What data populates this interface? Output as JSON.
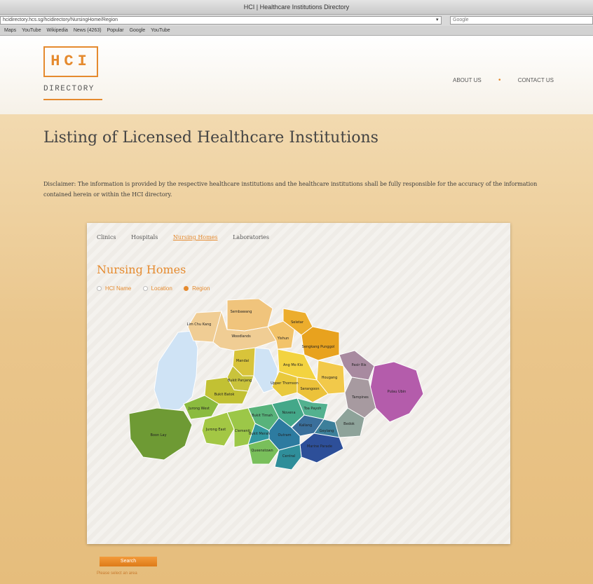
{
  "browser": {
    "window_title": "HCI | Healthcare Institutions Directory",
    "url": "hcidirectory.hcs.sg/hcidirectory/NursingHome/Region",
    "search_placeholder": "Google",
    "bookmarks": [
      "Maps",
      "YouTube",
      "Wikipedia",
      "News (4263)",
      "Popular",
      "Google",
      "YouTube"
    ]
  },
  "header": {
    "logo_text": "HCI",
    "logo_subtitle": "DIRECTORY",
    "nav": [
      "ABOUT US",
      "CONTACT US"
    ]
  },
  "page": {
    "title": "Listing of Licensed Healthcare Institutions",
    "disclaimer": "Disclaimer: The information is provided by the respective healthcare institutions and the healthcare institutions shall be fully responsible for the accuracy of the information contained herein or within the HCI directory."
  },
  "panel": {
    "tabs": [
      "Clinics",
      "Hospitals",
      "Nursing Homes",
      "Laboratories"
    ],
    "active_tab": "Nursing Homes",
    "section_title": "Nursing Homes",
    "search_by": [
      {
        "label": "HCI Name",
        "selected": false
      },
      {
        "label": "Location",
        "selected": false
      },
      {
        "label": "Region",
        "selected": true
      }
    ]
  },
  "map": {
    "regions": [
      {
        "name": "Lim Chu Kang",
        "color": "#f0cd94"
      },
      {
        "name": "Sembawang",
        "color": "#f0c47c"
      },
      {
        "name": "Woodlands",
        "color": "#f0cd94"
      },
      {
        "name": "Yishun",
        "color": "#f2c36a"
      },
      {
        "name": "Seletar",
        "color": "#ecad2d"
      },
      {
        "name": "Sengkang Punggol",
        "color": "#e8a21e"
      },
      {
        "name": "Pasir Ris",
        "color": "#a88aa0"
      },
      {
        "name": "Pulau Ubin",
        "color": "#b45cab"
      },
      {
        "name": "Tampines",
        "color": "#a79aa0"
      },
      {
        "name": "Hougang",
        "color": "#f2c94a"
      },
      {
        "name": "Ang Mo Kio",
        "color": "#f3d340"
      },
      {
        "name": "Serangoon",
        "color": "#ecc23a"
      },
      {
        "name": "Upper Thomson",
        "color": "#e9c93c"
      },
      {
        "name": "Mandai",
        "color": "#d8c43a"
      },
      {
        "name": "Bukit Panjang",
        "color": "#c9c33c"
      },
      {
        "name": "Bukit Batok",
        "color": "#c2c133"
      },
      {
        "name": "Jurong West",
        "color": "#8bbb3f"
      },
      {
        "name": "Jurong East",
        "color": "#a3c744"
      },
      {
        "name": "Boon Lay",
        "color": "#6e9a34"
      },
      {
        "name": "Clementi",
        "color": "#9cc748"
      },
      {
        "name": "Queenstown",
        "color": "#79bf5b"
      },
      {
        "name": "Bukit Timah",
        "color": "#58b37b"
      },
      {
        "name": "Novena",
        "color": "#44a889"
      },
      {
        "name": "Toa Payoh",
        "color": "#53b18f"
      },
      {
        "name": "Bedok",
        "color": "#8ea39a"
      },
      {
        "name": "Geylang",
        "color": "#3c7f9a"
      },
      {
        "name": "Kallang",
        "color": "#3a6f9b"
      },
      {
        "name": "Marine Parade",
        "color": "#2d4f99"
      },
      {
        "name": "Central",
        "color": "#2f8e9a"
      },
      {
        "name": "Outram",
        "color": "#2d7ba0"
      },
      {
        "name": "Bukit Merah",
        "color": "#3197a0"
      }
    ]
  },
  "footer": {
    "search_button": "Search",
    "hint": "Please select an area"
  }
}
